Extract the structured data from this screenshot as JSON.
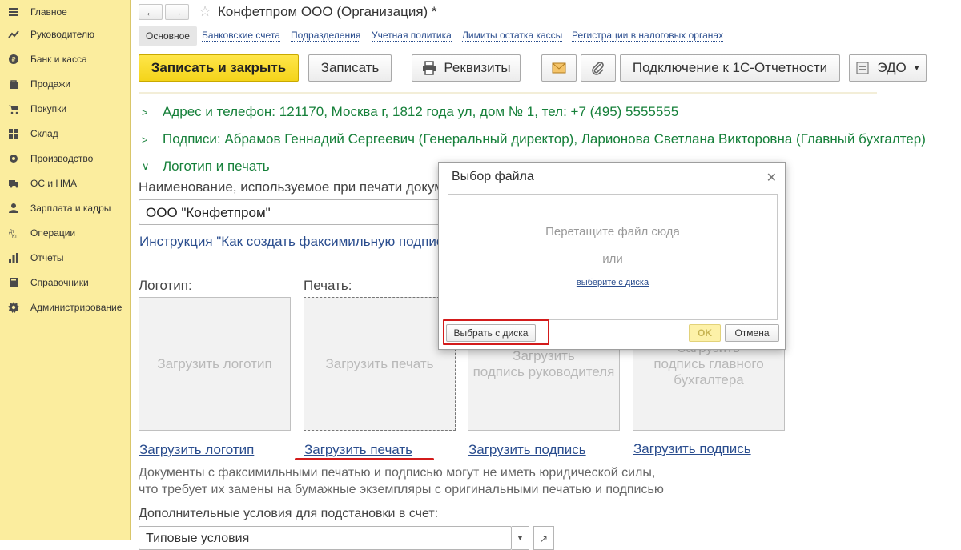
{
  "sidebar": {
    "items": [
      {
        "label": "Главное",
        "icon": "menu-icon"
      },
      {
        "label": "Руководителю",
        "icon": "trend-icon"
      },
      {
        "label": "Банк и касса",
        "icon": "coin-icon"
      },
      {
        "label": "Продажи",
        "icon": "bag-icon"
      },
      {
        "label": "Покупки",
        "icon": "cart-icon"
      },
      {
        "label": "Склад",
        "icon": "grid-icon"
      },
      {
        "label": "Производство",
        "icon": "gear-icon"
      },
      {
        "label": "ОС и НМА",
        "icon": "truck-icon"
      },
      {
        "label": "Зарплата и кадры",
        "icon": "person-icon"
      },
      {
        "label": "Операции",
        "icon": "operations-icon"
      },
      {
        "label": "Отчеты",
        "icon": "bar-chart-icon"
      },
      {
        "label": "Справочники",
        "icon": "book-icon"
      },
      {
        "label": "Администрирование",
        "icon": "settings-icon"
      }
    ]
  },
  "header": {
    "title": "Конфетпром ООО (Организация) *",
    "back_icon": "arrow-left-icon",
    "forward_icon": "arrow-right-icon",
    "favorite_icon": "star-icon"
  },
  "tabs": {
    "active": "Основное",
    "links": [
      "Банковские счета",
      "Подразделения",
      "Учетная политика",
      "Лимиты остатка кассы",
      "Регистрации в налоговых органах"
    ]
  },
  "toolbar": {
    "save_close": "Записать и закрыть",
    "save": "Записать",
    "details": "Реквизиты",
    "connect": "Подключение к 1С-Отчетности",
    "edo": "ЭДО"
  },
  "groups": {
    "address": "Адрес и телефон: 121170, Москва г, 1812 года ул, дом № 1, тел: +7 (495) 5555555",
    "signatures": "Подписи: Абрамов Геннадий Сергеевич (Генеральный директор), Ларионова Светлана Викторовна (Главный бухгалтер)",
    "logo_print": "Логотип и печать"
  },
  "form": {
    "name_label": "Наименование, используемое при печати докум",
    "name_value": "ООО \"Конфетпром\"",
    "instruction_link": "Инструкция \"Как создать факсимильную подпис",
    "logo_label": "Логотип:",
    "print_label": "Печать:"
  },
  "tiles": {
    "logo": "Загрузить логотип",
    "print": "Загрузить печать",
    "head_sign": "Загрузить\nподпись руководителя",
    "accountant_sign": "Загрузить\nподпись главного\nбухгалтера"
  },
  "tile_links": {
    "logo": "Загрузить логотип",
    "print": "Загрузить печать",
    "head_sign": "Загрузить подпись",
    "accountant_sign": "Загрузить подпись"
  },
  "note": {
    "line1": "Документы с факсимильными печатью и подписью могут не иметь юридической силы,",
    "line2": "что требует их замены на бумажные экземпляры с оригинальными печатью и подписью"
  },
  "extra": {
    "label": "Дополнительные условия для подстановки в счет:",
    "value": "Типовые условия"
  },
  "dialog": {
    "title": "Выбор файла",
    "drop_text": "Перетащите файл сюда",
    "or_text": "или",
    "choose_link": "выберите с диска",
    "choose_button": "Выбрать с диска",
    "ok": "OK",
    "cancel": "Отмена"
  }
}
